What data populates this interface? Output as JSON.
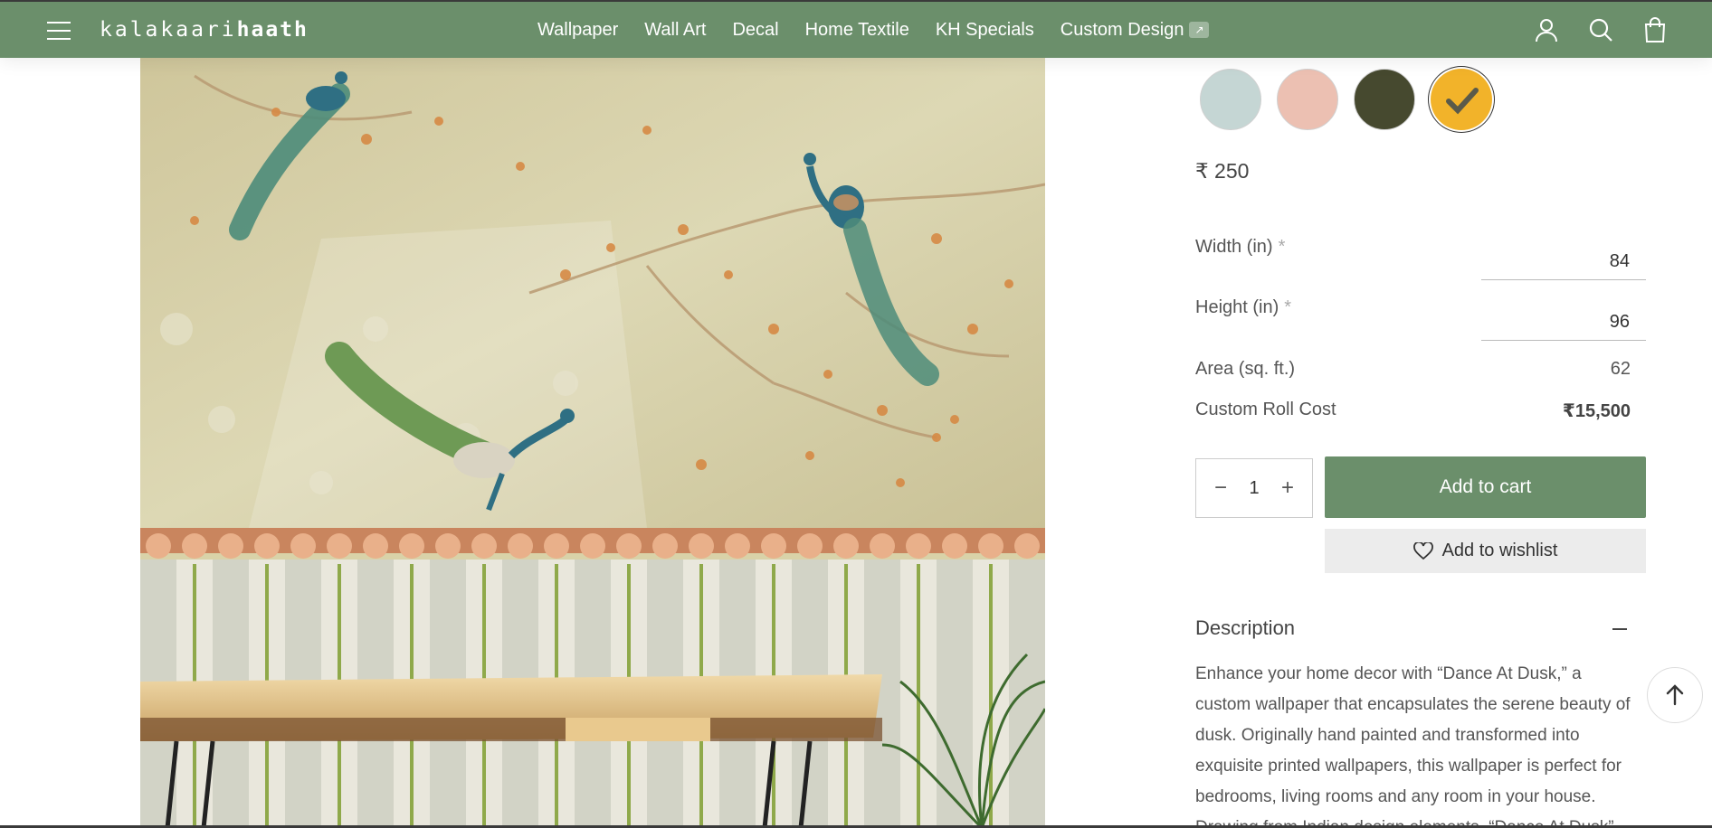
{
  "header": {
    "logo_light": "kalakaari",
    "logo_bold": "haath",
    "nav": [
      "Wallpaper",
      "Wall Art",
      "Decal",
      "Home Textile",
      "KH Specials",
      "Custom Design"
    ],
    "nav_badge": "↗",
    "icons": [
      "menu-icon",
      "account-icon",
      "search-icon",
      "cart-icon"
    ]
  },
  "product": {
    "swatches": [
      {
        "color": "#c5d6d4",
        "name": "sky-blue"
      },
      {
        "color": "#ecc0b2",
        "name": "pink"
      },
      {
        "color": "#46492f",
        "name": "olive-dark"
      },
      {
        "color": "#f2b32a",
        "name": "yellow",
        "selected": true
      }
    ],
    "price": "₹ 250",
    "width_label": "Width (in)",
    "width_value": "84",
    "height_label": "Height (in)",
    "height_value": "96",
    "required_mark": "*",
    "area_label": "Area (sq. ft.)",
    "area_value": "62",
    "cost_label": "Custom Roll Cost",
    "cost_value": "₹15,500",
    "qty_minus": "−",
    "qty_value": "1",
    "qty_plus": "+",
    "add_to_cart": "Add to cart",
    "add_to_wishlist": "Add to wishlist",
    "description_title": "Description",
    "description_text": "Enhance your home decor with “Dance At Dusk,” a custom wallpaper that encapsulates the serene beauty of dusk. Originally hand painted and transformed into exquisite printed wallpapers, this wallpaper is perfect for bedrooms, living rooms and any room in your house. Drawing from Indian design elements, “Dance At Dusk”"
  },
  "colors": {
    "brand": "#6b8f6b",
    "wishlist_bg": "#ececec"
  }
}
